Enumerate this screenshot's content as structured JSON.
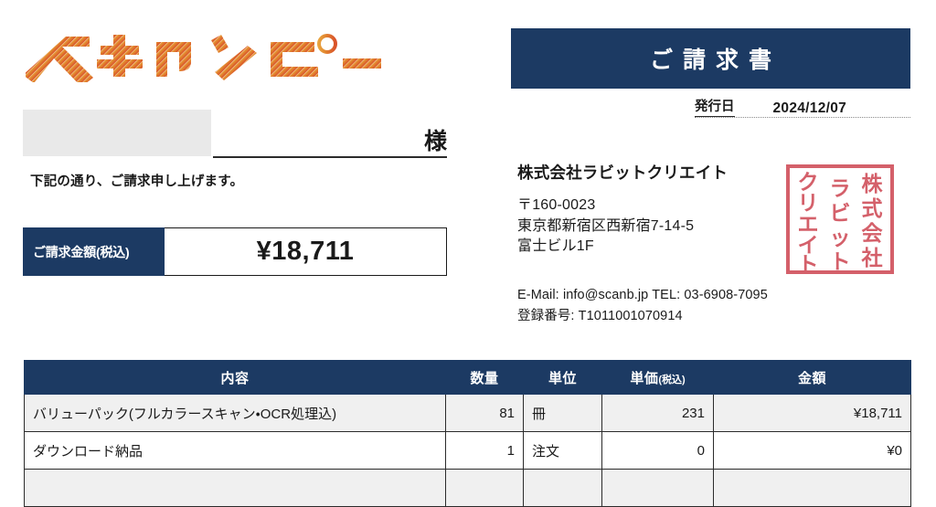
{
  "brand": {
    "logo_text": "スキャンピー",
    "logo_color_start": "#e8a33d",
    "logo_color_end": "#d9522a"
  },
  "header": {
    "title": "ご請求書",
    "title_bg": "#1c3a63",
    "issue_date_label": "発行日",
    "issue_date_value": "2024/12/07"
  },
  "customer": {
    "name": "",
    "honorific": "様",
    "intro_text": "下記の通り、ご請求申し上げます。"
  },
  "total": {
    "label": "ご請求金額(税込)",
    "value": "¥18,711"
  },
  "issuer": {
    "company_name": "株式会社ラビットクリエイト",
    "postal_code": "〒160-0023",
    "address_line1": "東京都新宿区西新宿7-14-5",
    "address_line2": "富士ビル1F",
    "contact_line": "E-Mail: info@scanb.jp   TEL: 03-6908-7095",
    "registration_line": "登録番号: T1011001070914",
    "seal": {
      "color": "#d4606a",
      "column_right": "株式会社",
      "column_middle": "ラビット",
      "column_left": "クリエイト"
    }
  },
  "items_table": {
    "columns": [
      {
        "label": "内容",
        "sub": ""
      },
      {
        "label": "数量",
        "sub": ""
      },
      {
        "label": "単位",
        "sub": ""
      },
      {
        "label": "単価",
        "sub": "(税込)"
      },
      {
        "label": "金額",
        "sub": ""
      }
    ],
    "rows": [
      {
        "description": "バリューパック(フルカラースキャン・OCR処理込)",
        "quantity": "81",
        "unit": "冊",
        "unit_price": "231",
        "amount": "¥18,711"
      },
      {
        "description": "ダウンロード納品",
        "quantity": "1",
        "unit": "注文",
        "unit_price": "0",
        "amount": "¥0"
      },
      {
        "description": "",
        "quantity": "",
        "unit": "",
        "unit_price": "",
        "amount": ""
      }
    ]
  }
}
